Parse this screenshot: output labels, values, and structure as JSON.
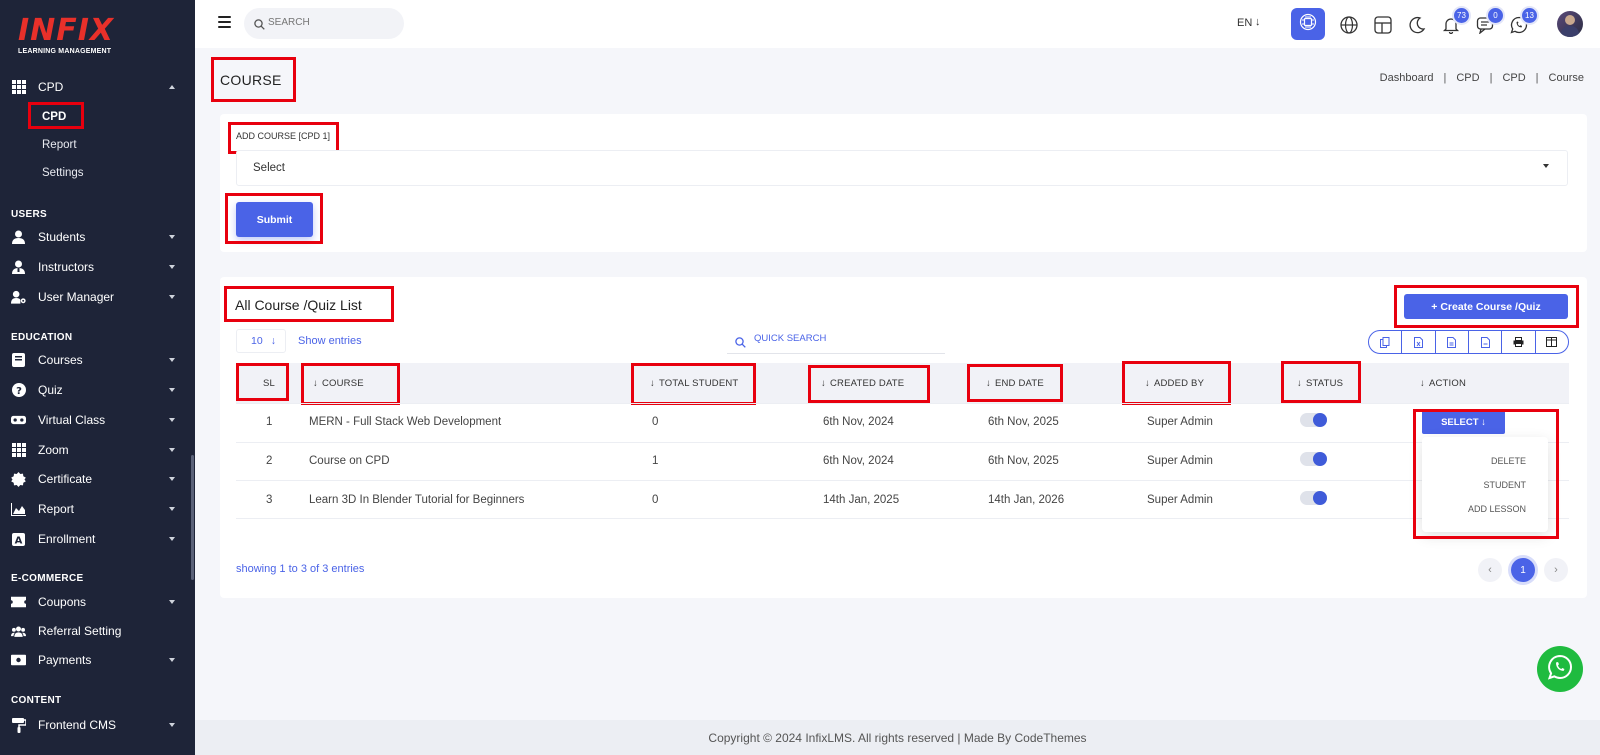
{
  "brand": {
    "name": "INFIX",
    "subtitle": "LEARNING MANAGEMENT",
    "accent": "#4a63e7",
    "logo_color": "#e8302a"
  },
  "sidebar": {
    "cpd": {
      "label": "CPD",
      "items": [
        "CPD",
        "Report",
        "Settings"
      ]
    },
    "sections": {
      "users": "USERS",
      "education": "EDUCATION",
      "ecommerce": "E-COMMERCE",
      "content": "CONTENT"
    },
    "users_items": [
      "Students",
      "Instructors",
      "User Manager"
    ],
    "education_items": [
      "Courses",
      "Quiz",
      "Virtual Class",
      "Zoom",
      "Certificate",
      "Report",
      "Enrollment"
    ],
    "ecommerce_items": [
      "Coupons",
      "Referral Setting",
      "Payments"
    ],
    "content_items": [
      "Frontend CMS"
    ]
  },
  "topbar": {
    "search_placeholder": "SEARCH",
    "language": "EN",
    "badges": {
      "notifications": "73",
      "messages": "0",
      "whatsapp": "13"
    }
  },
  "page": {
    "title": "COURSE",
    "breadcrumb": [
      "Dashboard",
      "CPD",
      "CPD",
      "Course"
    ]
  },
  "add_form": {
    "label": "ADD COURSE [CPD 1]",
    "select_value": "Select",
    "submit_label": "Submit"
  },
  "list": {
    "title": "All Course /Quiz List",
    "create_label": "+ Create Course /Quiz",
    "entries_value": "10",
    "show_entries": "Show entries",
    "quick_search_placeholder": "QUICK SEARCH",
    "columns": [
      "SL",
      "COURSE",
      "TOTAL STUDENT",
      "CREATED DATE",
      "END DATE",
      "ADDED BY",
      "STATUS",
      "ACTION"
    ],
    "rows": [
      {
        "sl": "1",
        "course": "MERN - Full Stack Web Development",
        "total_student": "0",
        "created": "6th Nov, 2024",
        "end": "6th Nov, 2025",
        "added_by": "Super Admin",
        "status": true
      },
      {
        "sl": "2",
        "course": "Course on CPD",
        "total_student": "1",
        "created": "6th Nov, 2024",
        "end": "6th Nov, 2025",
        "added_by": "Super Admin",
        "status": true
      },
      {
        "sl": "3",
        "course": "Learn 3D In Blender Tutorial for Beginners",
        "total_student": "0",
        "created": "14th Jan, 2025",
        "end": "14th Jan, 2026",
        "added_by": "Super Admin",
        "status": true
      }
    ],
    "action_button": "SELECT",
    "action_menu": [
      "DELETE",
      "STUDENT",
      "ADD LESSON"
    ],
    "showing": "showing 1 to 3 of 3 entries",
    "current_page": "1"
  },
  "footer": {
    "text": "Copyright © 2024 InfixLMS. All rights reserved | Made By CodeThemes"
  }
}
